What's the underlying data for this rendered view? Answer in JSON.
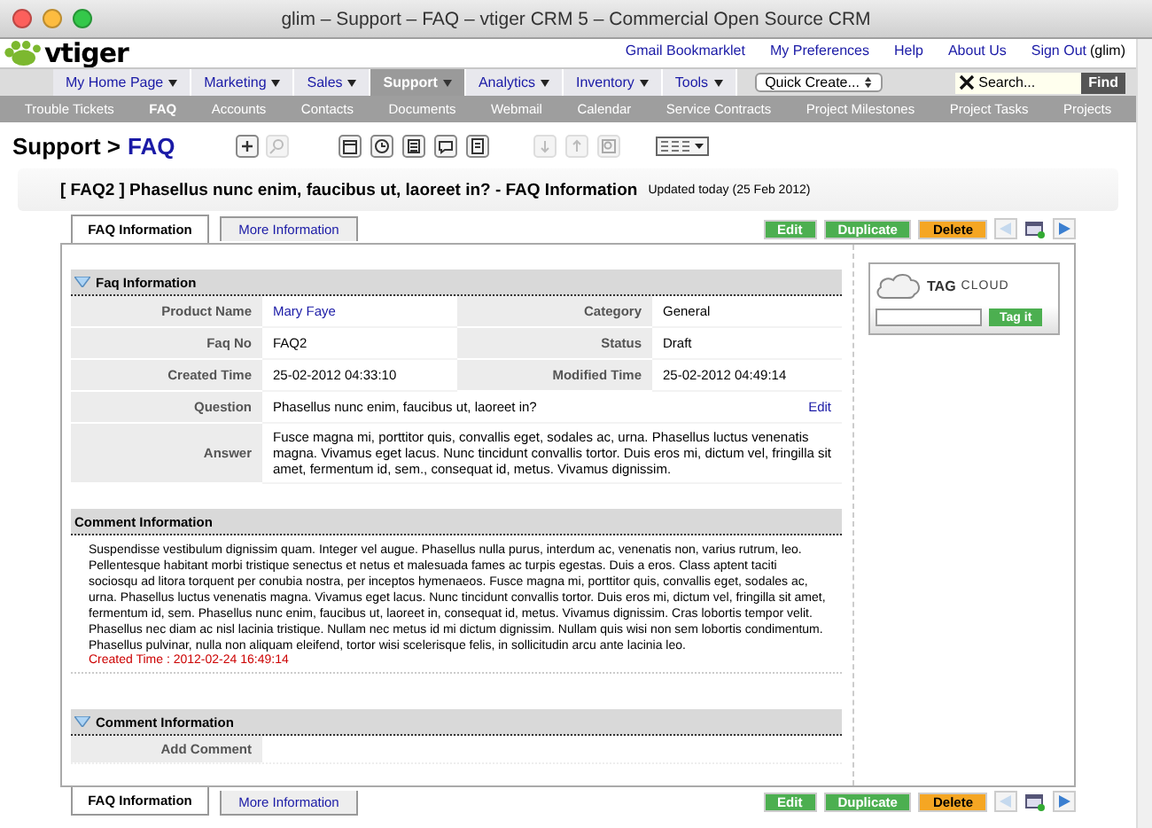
{
  "window": {
    "title": "glim – Support – FAQ – vtiger CRM 5 – Commercial Open Source CRM"
  },
  "header": {
    "logo_text": "vtiger",
    "links": [
      {
        "label": "Gmail Bookmarklet"
      },
      {
        "label": "My Preferences"
      },
      {
        "label": "Help"
      },
      {
        "label": "About Us"
      },
      {
        "label": "Sign Out"
      }
    ],
    "user": "(glim)"
  },
  "main_nav": [
    {
      "label": "My Home Page",
      "selected": false
    },
    {
      "label": "Marketing",
      "selected": false
    },
    {
      "label": "Sales",
      "selected": false
    },
    {
      "label": "Support",
      "selected": true
    },
    {
      "label": "Analytics",
      "selected": false
    },
    {
      "label": "Inventory",
      "selected": false
    },
    {
      "label": "Tools",
      "selected": false
    }
  ],
  "quick_create": "Quick Create...",
  "search": {
    "placeholder": "Search...",
    "button": "Find"
  },
  "sub_nav": [
    {
      "label": "Trouble Tickets",
      "selected": false
    },
    {
      "label": "FAQ",
      "selected": true
    },
    {
      "label": "Accounts",
      "selected": false
    },
    {
      "label": "Contacts",
      "selected": false
    },
    {
      "label": "Documents",
      "selected": false
    },
    {
      "label": "Webmail",
      "selected": false
    },
    {
      "label": "Calendar",
      "selected": false
    },
    {
      "label": "Service Contracts",
      "selected": false
    },
    {
      "label": "Project Milestones",
      "selected": false
    },
    {
      "label": "Project Tasks",
      "selected": false
    },
    {
      "label": "Projects",
      "selected": false
    }
  ],
  "breadcrumb": {
    "module": "Support >",
    "page": "FAQ"
  },
  "record": {
    "title": "[ FAQ2 ] Phasellus nunc enim, faucibus ut, laoreet in? - FAQ Information",
    "updated": "Updated today",
    "date": "(25 Feb 2012)"
  },
  "tabs": [
    {
      "label": "FAQ Information",
      "selected": true
    },
    {
      "label": "More Information",
      "selected": false
    }
  ],
  "buttons": [
    {
      "label": "Edit",
      "kind": "primary"
    },
    {
      "label": "Duplicate",
      "kind": "primary"
    },
    {
      "label": "Delete",
      "kind": "warning"
    }
  ],
  "pager": {
    "previous_disabled": true,
    "next_disabled": false
  },
  "faq_section": {
    "title": "Faq Information",
    "expanded": true,
    "fields": [
      {
        "label": "Product Name",
        "value": "Mary Faye",
        "kind": "link"
      },
      {
        "label": "Category",
        "value": "General",
        "kind": "text"
      },
      {
        "label": "Faq No",
        "value": "FAQ2",
        "kind": "text"
      },
      {
        "label": "Status",
        "value": "Draft",
        "kind": "text"
      },
      {
        "label": "Created Time",
        "value": "25-02-2012 04:33:10",
        "kind": "text"
      },
      {
        "label": "Modified Time",
        "value": "25-02-2012 04:49:14",
        "kind": "text"
      }
    ],
    "question_label": "Question",
    "question": "Phasellus nunc enim, faucibus ut, laoreet in?",
    "edit_link": "Edit",
    "answer_label": "Answer",
    "answer": "Fusce magna mi, porttitor quis, convallis eget, sodales ac, urna. Phasellus luctus venenatis magna. Vivamus eget lacus. Nunc tincidunt convallis tortor. Duis eros mi, dictum vel, fringilla sit amet, fermentum id, sem., consequat id, metus. Vivamus dignissim."
  },
  "comments": {
    "title": "Comment Information",
    "text": "Suspendisse vestibulum dignissim quam. Integer vel augue. Phasellus nulla purus, interdum ac, venenatis non, varius rutrum, leo. Pellentesque habitant morbi tristique senectus et netus et malesuada fames ac turpis egestas. Duis a eros. Class aptent taciti sociosqu ad litora torquent per conubia nostra, per inceptos hymenaeos. Fusce magna mi, porttitor quis, convallis eget, sodales ac, urna. Phasellus luctus venenatis magna. Vivamus eget lacus. Nunc tincidunt convallis tortor. Duis eros mi, dictum vel, fringilla sit amet, fermentum id, sem. Phasellus nunc enim, faucibus ut, laoreet in, consequat id, metus. Vivamus dignissim. Cras lobortis tempor velit. Phasellus nec diam ac nisl lacinia tristique. Nullam nec metus id mi dictum dignissim. Nullam quis wisi non sem lobortis condimentum. Phasellus pulvinar, nulla non aliquam eleifend, tortor wisi scelerisque felis, in sollicitudin arcu ante lacinia leo.",
    "created": "Created Time : 2012-02-24 16:49:14"
  },
  "comment_form": {
    "title": "Comment Information",
    "expanded": true,
    "label": "Add Comment"
  },
  "tag_cloud": {
    "title": "TAG",
    "subtitle": "CLOUD",
    "button": "Tag it"
  },
  "bottom_tabs": [
    {
      "label": "FAQ Information",
      "selected": true
    },
    {
      "label": "More Information",
      "selected": false
    }
  ],
  "bottom_buttons": [
    {
      "label": "Edit",
      "kind": "primary"
    },
    {
      "label": "Duplicate",
      "kind": "primary"
    },
    {
      "label": "Delete",
      "kind": "warning"
    }
  ],
  "bottom_pager": {
    "previous_disabled": true,
    "next_disabled": false
  }
}
